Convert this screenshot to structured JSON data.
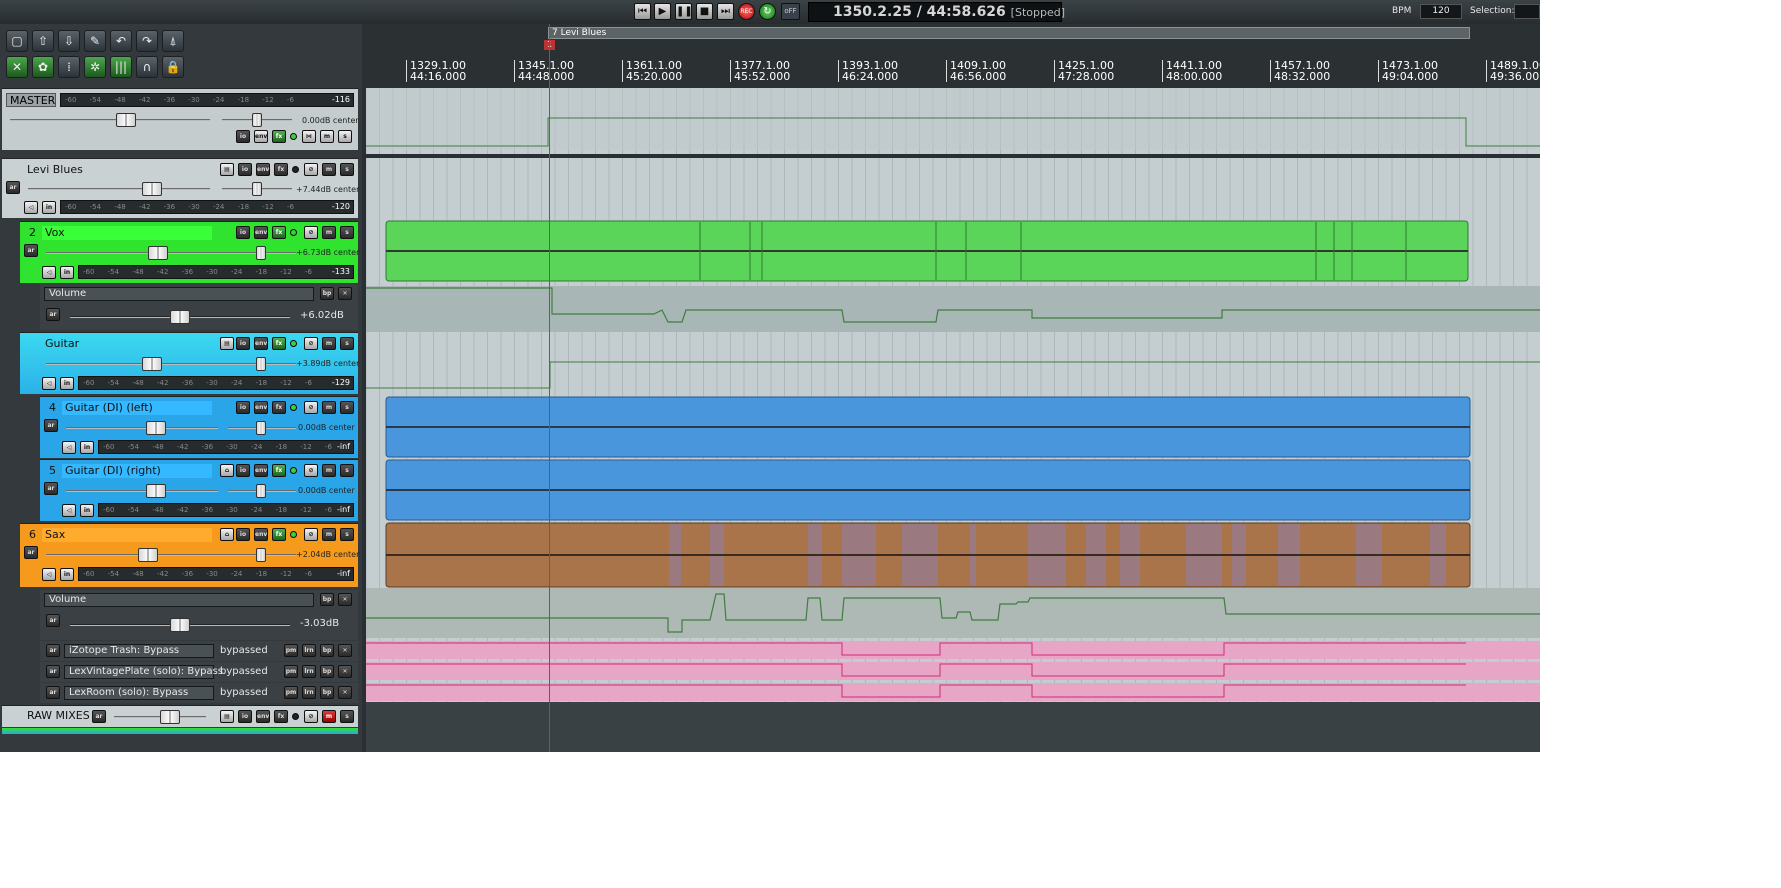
{
  "transport": {
    "clock": "1350.2.25 / 44:58.626",
    "status": "[Stopped]",
    "bpm_label": "BPM",
    "bpm_value": "120",
    "selection_label": "Selection:",
    "rec_label": "REC",
    "off_label": "oFF"
  },
  "region": {
    "name": "7 Levi Blues",
    "marker": "1"
  },
  "ruler": [
    {
      "bar": "1329.1.00",
      "time": "44:16.000"
    },
    {
      "bar": "1345.1.00",
      "time": "44:48.000"
    },
    {
      "bar": "1361.1.00",
      "time": "45:20.000"
    },
    {
      "bar": "1377.1.00",
      "time": "45:52.000"
    },
    {
      "bar": "1393.1.00",
      "time": "46:24.000"
    },
    {
      "bar": "1409.1.00",
      "time": "46:56.000"
    },
    {
      "bar": "1425.1.00",
      "time": "47:28.000"
    },
    {
      "bar": "1441.1.00",
      "time": "48:00.000"
    },
    {
      "bar": "1457.1.00",
      "time": "48:32.000"
    },
    {
      "bar": "1473.1.00",
      "time": "49:04.000"
    },
    {
      "bar": "1489.1.00",
      "time": "49:36.000"
    }
  ],
  "meter_scale": "-60 -54 -48 -42 -36 -30 -24 -18 -12 -6",
  "labels": {
    "io": "io",
    "env": "env",
    "fx": "fx",
    "m": "m",
    "s": "s",
    "ar": "ar",
    "bp": "bp",
    "pm": "pm",
    "lrn": "lrn",
    "in": "in",
    "close": "✕"
  },
  "master": {
    "name": "MASTER",
    "peak": "-116",
    "vol": "0.00dB center"
  },
  "tracks": [
    {
      "num": "",
      "name": "Levi Blues",
      "vol": "+7.44dB center",
      "peak": "-120",
      "color": "#c9d1d3"
    },
    {
      "num": "2",
      "name": "Vox",
      "vol": "+6.73dB center",
      "peak": "-133",
      "color": "#2fe32f"
    },
    {
      "num": "",
      "name": "Guitar",
      "vol": "+3.89dB center",
      "peak": "-129",
      "color": "#3cd8f0"
    },
    {
      "num": "4",
      "name": "Guitar (DI) (left)",
      "vol": "0.00dB center",
      "peak": "-inf",
      "color": "#2aa6e8"
    },
    {
      "num": "5",
      "name": "Guitar (DI) (right)",
      "vol": "0.00dB center",
      "peak": "-inf",
      "color": "#2aa6e8"
    },
    {
      "num": "6",
      "name": "Sax",
      "vol": "+2.04dB center",
      "peak": "-inf",
      "color": "#f59a1c"
    },
    {
      "num": "",
      "name": "RAW MIXES",
      "vol": "",
      "peak": "",
      "color": "#c9d1d3"
    }
  ],
  "envelopes": {
    "vox": {
      "name": "Volume",
      "value": "+6.02dB"
    },
    "sax": {
      "name": "Volume",
      "value": "-3.03dB"
    },
    "bypass": [
      {
        "name": "iZotope Trash: Bypass",
        "state": "bypassed"
      },
      {
        "name": "LexVintagePlate (solo): Bypass",
        "state": "bypassed"
      },
      {
        "name": "LexRoom (solo): Bypass",
        "state": "bypassed"
      }
    ]
  },
  "colors": {
    "vox_item": "#5ad55a",
    "guitar_item": "#4a96dc",
    "sax_item": "#a9744a",
    "bypass_lane": "#e7a6c6",
    "cursor": "#c0392b"
  },
  "icons": [
    "new-file-icon",
    "open-icon",
    "save-icon",
    "wrench-icon",
    "undo-icon",
    "redo-icon",
    "metronome-icon",
    "grid-icon",
    "snap-icon",
    "ripple-icon",
    "lock-icon"
  ]
}
